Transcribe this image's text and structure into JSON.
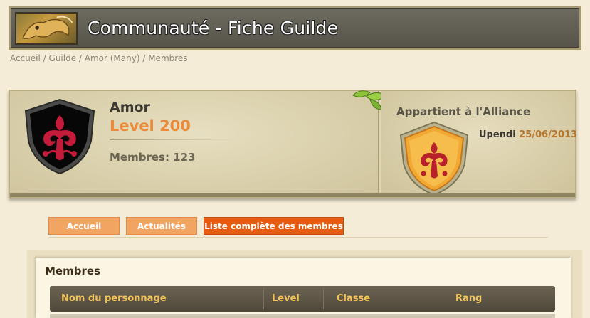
{
  "header": {
    "title": "Communauté - Fiche Guilde"
  },
  "breadcrumb": {
    "text": "Accueil / Guilde / Amor (Many) / Membres"
  },
  "guild": {
    "name": "Amor",
    "level": "Level 200",
    "members": "Membres: 123",
    "emblem_color": "#c41b3a"
  },
  "alliance": {
    "title": "Appartient à l'Alliance",
    "name": "Upendi",
    "date": "25/06/2013"
  },
  "tabs": [
    {
      "label": "Accueil",
      "active": false
    },
    {
      "label": "Actualités",
      "active": false
    },
    {
      "label": "Liste complète des membres",
      "active": true
    }
  ],
  "members": {
    "title": "Membres",
    "columns": [
      "Nom du personnage",
      "Level",
      "Classe",
      "Rang"
    ]
  },
  "colors": {
    "accent": "#e55c12",
    "tab": "#f2a463",
    "level": "#ea8a3a",
    "table_header_text": "#f1c45a"
  }
}
